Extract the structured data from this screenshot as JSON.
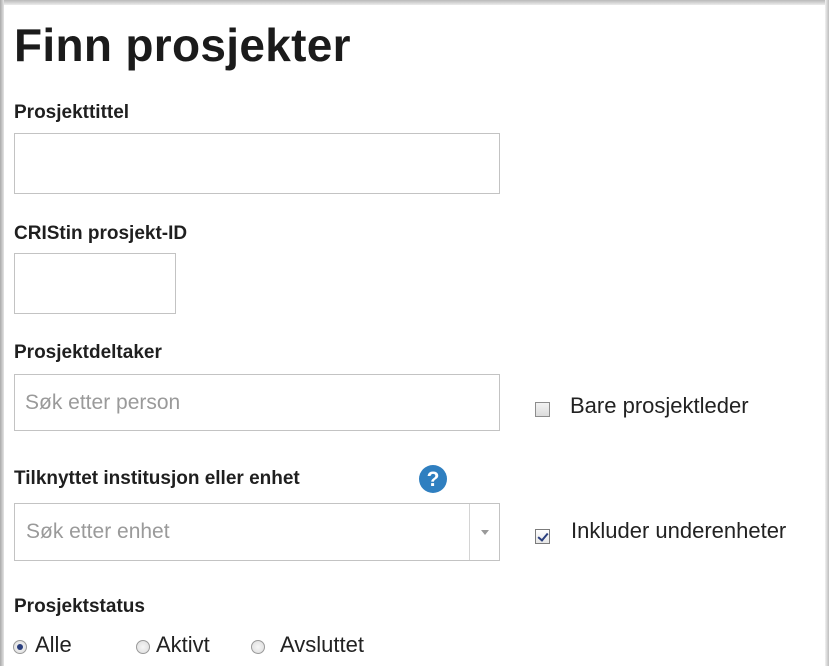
{
  "page": {
    "title": "Finn prosjekter"
  },
  "fields": {
    "project_title": {
      "label": "Prosjekttittel",
      "value": "",
      "placeholder": ""
    },
    "cristin_id": {
      "label": "CRIStin prosjekt-ID",
      "value": "",
      "placeholder": ""
    },
    "participant": {
      "label": "Prosjektdeltaker",
      "value": "",
      "placeholder": "Søk etter person",
      "checkbox_label": "Bare prosjektleder",
      "checkbox_checked": false
    },
    "institution": {
      "label": "Tilknyttet institusjon eller enhet",
      "help_icon": "question-mark-circle-icon",
      "placeholder": "Søk etter enhet",
      "checkbox_label": "Inkluder underenheter",
      "checkbox_checked": true
    },
    "status": {
      "label": "Prosjektstatus",
      "options": [
        "Alle",
        "Aktivt",
        "Avsluttet"
      ],
      "selected": "Alle"
    }
  },
  "colors": {
    "help_icon": "#2f7fc0",
    "check_mark": "#2a3e7d"
  }
}
